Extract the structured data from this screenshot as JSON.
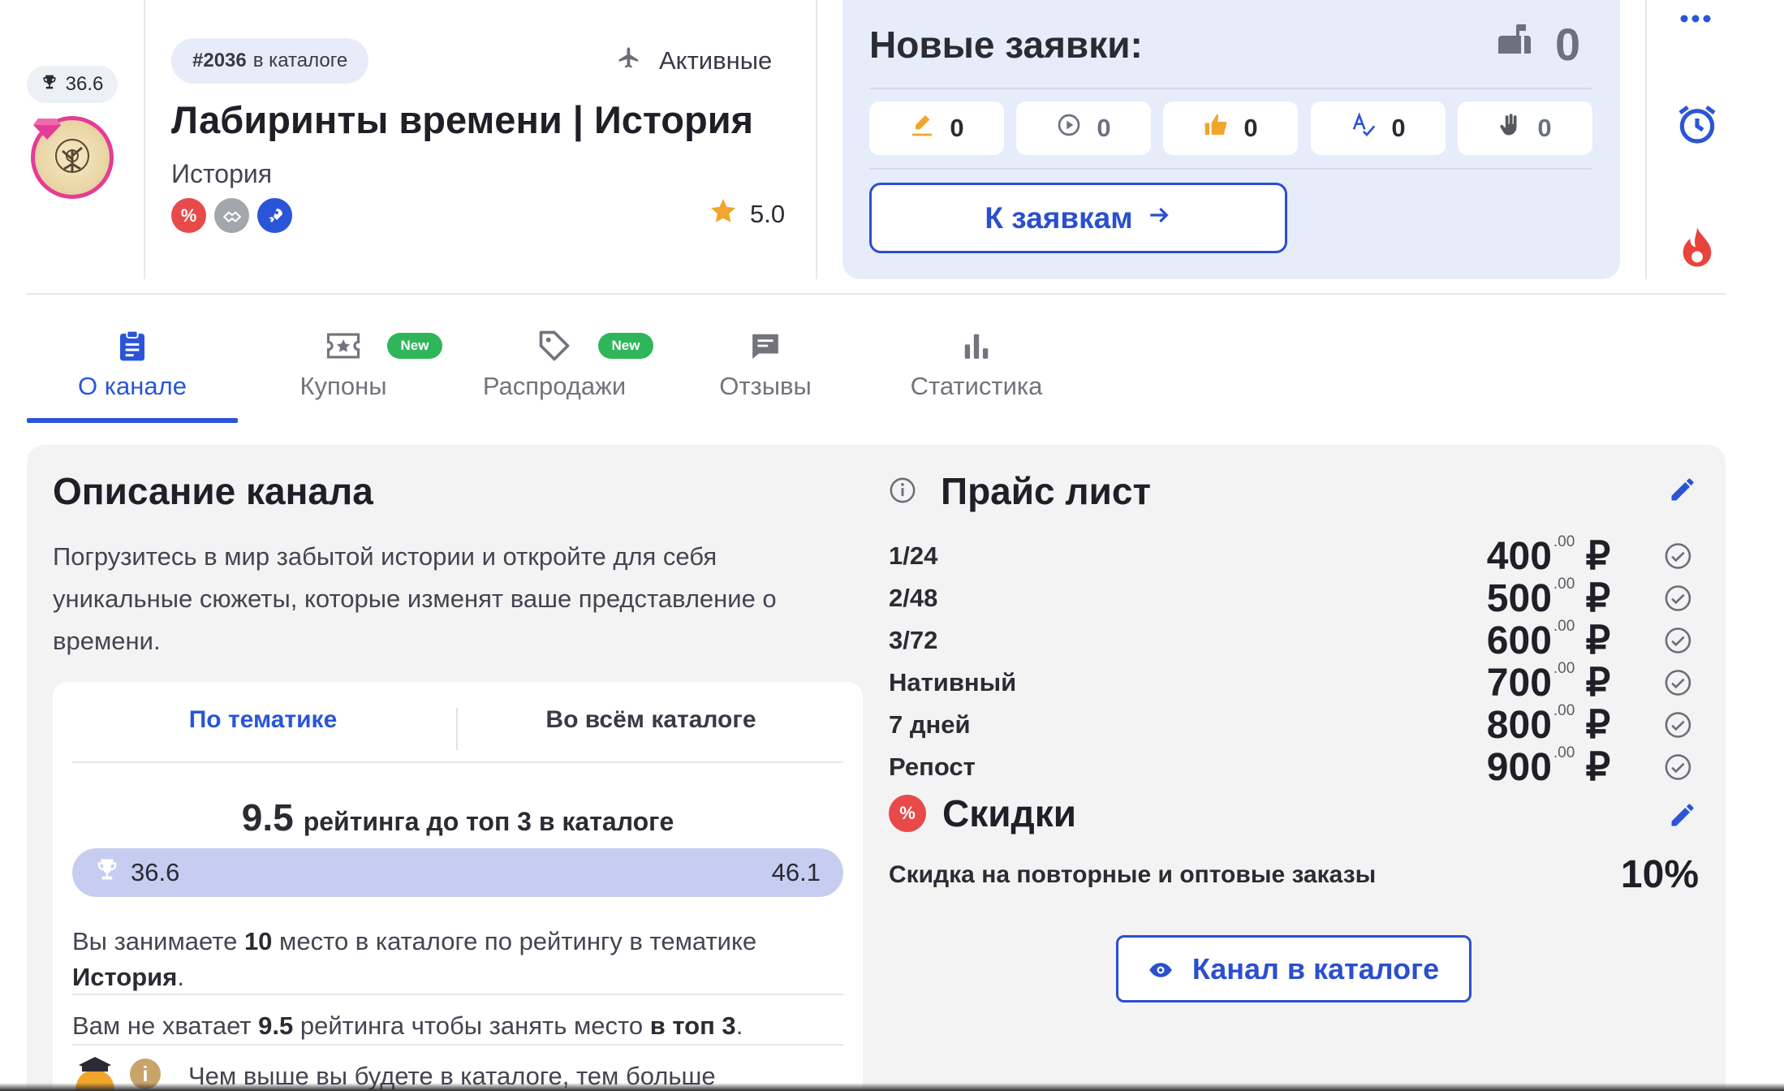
{
  "header": {
    "rating": "36.6",
    "catalog_number": "#2036",
    "catalog_suffix": "в каталоге",
    "status": "Активные",
    "channel_title": "Лабиринты времени | История",
    "channel_category": "История",
    "stars": "5.0",
    "tags": [
      {
        "name": "discount-tag",
        "glyph": "%",
        "color": "#e84a4a"
      },
      {
        "name": "handshake-tag",
        "glyph": "🤝",
        "color": "#a3a6ad"
      },
      {
        "name": "rocket-tag",
        "glyph": "🚀",
        "color": "#2a55d8"
      }
    ]
  },
  "requests": {
    "title": "Новые заявки:",
    "total": "0",
    "cells": [
      {
        "icon": "pencil-icon",
        "count": "0"
      },
      {
        "icon": "play-icon",
        "count": "0"
      },
      {
        "icon": "thumbs-up-icon",
        "count": "0"
      },
      {
        "icon": "spellcheck-icon",
        "count": "0"
      },
      {
        "icon": "hand-icon",
        "count": "0"
      }
    ],
    "button_label": "К заявкам"
  },
  "tabs": [
    {
      "label": "О канале",
      "active": true
    },
    {
      "label": "Купоны",
      "badge": "New"
    },
    {
      "label": "Распродажи",
      "badge": "New"
    },
    {
      "label": "Отзывы"
    },
    {
      "label": "Статистика"
    }
  ],
  "description": {
    "title": "Описание канала",
    "text": "Погрузитесь в мир забытой истории и откройте для себя уникальные сюжеты, которые изменят ваше представление о времени."
  },
  "ranking": {
    "tab_topic": "По тематике",
    "tab_all": "Во всём каталоге",
    "headline_value": "9.5",
    "headline_text": "рейтинга до топ 3 в каталоге",
    "progress_current": "36.6",
    "progress_target": "46.1",
    "p1_a": "Вы занимаете ",
    "p1_place": "10",
    "p1_b": " место в каталоге по рейтингу в тематике ",
    "p1_topic": "История",
    "p1_c": ".",
    "p2_a": "Вам не хватает ",
    "p2_value": "9.5",
    "p2_b": " рейтинга чтобы занять место ",
    "p2_top": "в топ 3",
    "p2_c": ".",
    "p3": "Чем выше вы будете в каталоге, тем больше"
  },
  "price_list": {
    "title": "Прайс лист",
    "rows": [
      {
        "name": "1/24",
        "price": "400",
        "cents": ".00",
        "currency": "₽"
      },
      {
        "name": "2/48",
        "price": "500",
        "cents": ".00",
        "currency": "₽"
      },
      {
        "name": "3/72",
        "price": "600",
        "cents": ".00",
        "currency": "₽"
      },
      {
        "name": "Нативный",
        "price": "700",
        "cents": ".00",
        "currency": "₽"
      },
      {
        "name": "7 дней",
        "price": "800",
        "cents": ".00",
        "currency": "₽"
      },
      {
        "name": "Репост",
        "price": "900",
        "cents": ".00",
        "currency": "₽"
      }
    ]
  },
  "discounts": {
    "title": "Скидки",
    "label": "Скидка на повторные и оптовые заказы",
    "value": "10%"
  },
  "catalog_button": "Канал в каталоге",
  "colors": {
    "accent": "#2a55d8",
    "panel_blue": "#e7ecfa",
    "new_badge": "#2fb55a",
    "fire": "#e8433d"
  }
}
